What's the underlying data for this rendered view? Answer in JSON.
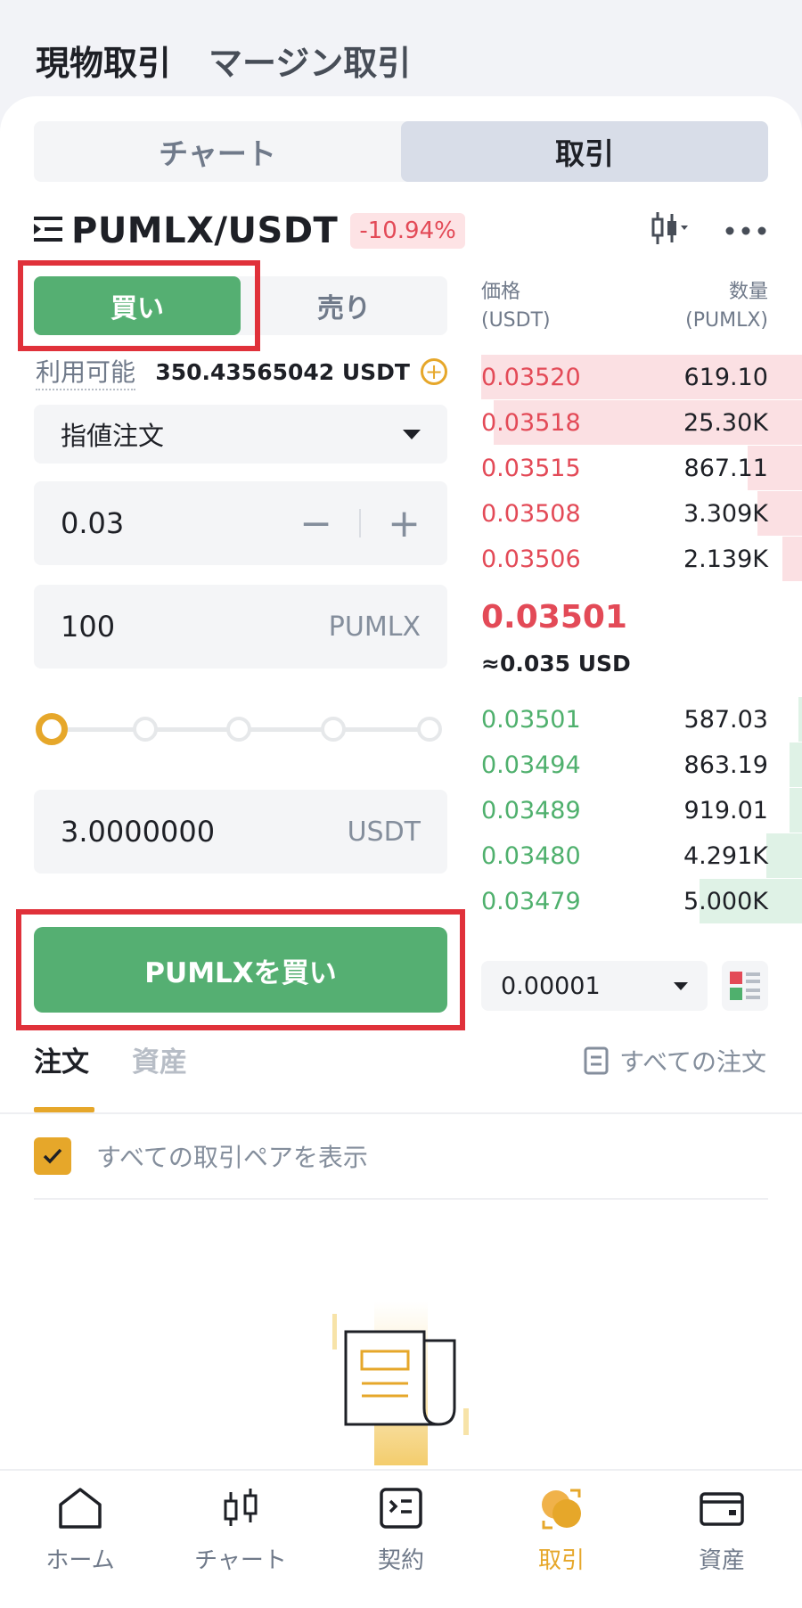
{
  "header": {
    "tabs": [
      "現物取引",
      "マージン取引"
    ]
  },
  "segment": {
    "tabs": [
      "チャート",
      "取引"
    ]
  },
  "pair": {
    "name": "PUMLX/USDT",
    "change": "-10.94%"
  },
  "trade": {
    "buy_label": "買い",
    "sell_label": "売り",
    "available_label": "利用可能",
    "available_value": "350.43565042 USDT",
    "order_type": "指値注文",
    "price_value": "0.03",
    "stepper_minus": "−",
    "stepper_plus": "+",
    "quantity_value": "100",
    "quantity_unit": "PUMLX",
    "slider_level_percent": 0,
    "total_value": "3.0000000",
    "total_unit": "USDT",
    "submit_label": "PUMLXを買い"
  },
  "orderbook": {
    "price_header": "価格",
    "price_unit": "(USDT)",
    "qty_header": "数量",
    "qty_unit": "(PUMLX)",
    "asks": [
      {
        "price": "0.03520",
        "qty": "619.10",
        "depth": 1.0
      },
      {
        "price": "0.03518",
        "qty": "25.30K",
        "depth": 0.96
      },
      {
        "price": "0.03515",
        "qty": "867.11",
        "depth": 0.17
      },
      {
        "price": "0.03508",
        "qty": "3.309K",
        "depth": 0.14
      },
      {
        "price": "0.03506",
        "qty": "2.139K",
        "depth": 0.06
      }
    ],
    "last_price": "0.03501",
    "last_price_usd": "≈0.035 USD",
    "bids": [
      {
        "price": "0.03501",
        "qty": "587.03",
        "depth": 0.01
      },
      {
        "price": "0.03494",
        "qty": "863.19",
        "depth": 0.04
      },
      {
        "price": "0.03489",
        "qty": "919.01",
        "depth": 0.04
      },
      {
        "price": "0.03480",
        "qty": "4.291K",
        "depth": 0.11
      },
      {
        "price": "0.03479",
        "qty": "5.000K",
        "depth": 0.32
      }
    ],
    "precision": "0.00001"
  },
  "orders": {
    "tabs": [
      "注文",
      "資産"
    ],
    "all_orders_label": "すべての注文",
    "show_all_pairs_label": "すべての取引ペアを表示"
  },
  "nav": {
    "items": [
      "ホーム",
      "チャート",
      "契約",
      "取引",
      "資産"
    ]
  },
  "colors": {
    "buy": "#55af72",
    "sell": "#e34a57",
    "accent": "#e6a72a",
    "highlight_frame": "#e0313a"
  }
}
